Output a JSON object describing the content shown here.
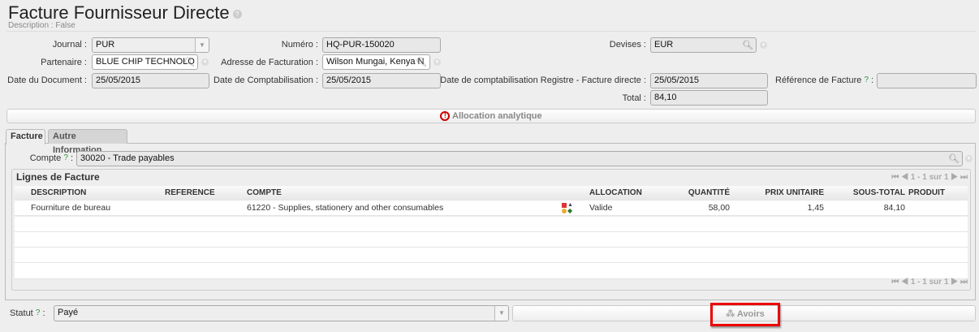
{
  "header": {
    "title": "Facture Fournisseur Directe",
    "help": "?",
    "description": "Description : False"
  },
  "form": {
    "journal": {
      "label": "Journal :",
      "value": "PUR"
    },
    "numero": {
      "label": "Numéro :",
      "value": "HQ-PUR-150020"
    },
    "devises": {
      "label": "Devises :",
      "value": "EUR"
    },
    "partenaire": {
      "label": "Partenaire :",
      "value": "BLUE CHIP TECHNOLO"
    },
    "adresse": {
      "label": "Adresse de Facturation :",
      "value": "Wilson Mungai, Kenya N"
    },
    "date_document": {
      "label": "Date du Document :",
      "value": "25/05/2015"
    },
    "date_compta": {
      "label": "Date de Comptabilisation :",
      "value": "25/05/2015"
    },
    "date_registre": {
      "label": "Date de comptabilisation Registre - Facture directe :",
      "value": "25/05/2015"
    },
    "reference": {
      "label": "Référence de Facture",
      "help": "?",
      "colon": ":",
      "value": ""
    },
    "total": {
      "label": "Total :",
      "value": "84,10"
    }
  },
  "allocation_bar": {
    "label": "Allocation analytique"
  },
  "tabs": [
    {
      "label": "Facture",
      "active": true
    },
    {
      "label": "Autre Information",
      "active": false
    }
  ],
  "compte": {
    "label": "Compte",
    "help": "?",
    "colon": ":",
    "value": "30020 - Trade payables"
  },
  "lines": {
    "title": "Lignes de Facture",
    "pager": "1 - 1 sur 1",
    "columns": [
      "DESCRIPTION",
      "REFERENCE",
      "COMPTE",
      "ALLOCATION",
      "QUANTITÉ",
      "PRIX UNITAIRE",
      "SOUS-TOTAL",
      "PRODUIT"
    ],
    "rows": [
      {
        "description": "Fourniture de bureau",
        "reference": "",
        "compte": "61220 - Supplies, stationery and other consumables",
        "allocation": "Valide",
        "quantite": "58,00",
        "prix": "1,45",
        "sous_total": "84,10",
        "produit": ""
      }
    ]
  },
  "statut": {
    "label": "Statut",
    "help": "?",
    "colon": ":",
    "value": "Payé"
  },
  "avoirs": {
    "label": "Avoirs"
  }
}
